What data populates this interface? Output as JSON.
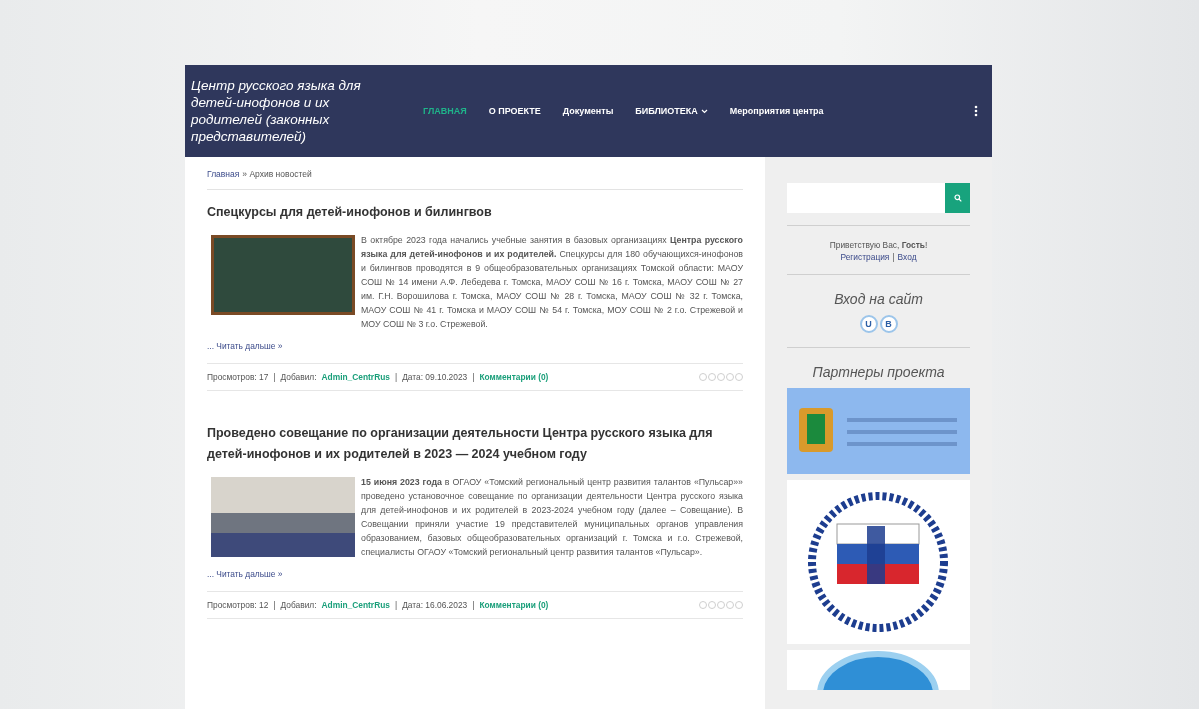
{
  "header": {
    "site_title": "Центр русского языка для детей-инофонов и их родителей (законных представителей)",
    "nav": [
      {
        "label": "ГЛАВНАЯ",
        "selected": true,
        "dropdown": false
      },
      {
        "label": "О ПРОЕКТЕ",
        "selected": false,
        "dropdown": false
      },
      {
        "label": "Документы",
        "selected": false,
        "dropdown": false
      },
      {
        "label": "БИБЛИОТЕКА",
        "selected": false,
        "dropdown": true
      },
      {
        "label": "Мероприятия центра",
        "selected": false,
        "dropdown": false
      }
    ]
  },
  "breadcrumb": [
    {
      "text": "Главная",
      "kind": "link"
    },
    {
      "text": "» Архив новостей",
      "kind": "text"
    }
  ],
  "articles": [
    {
      "title": "Спецкурсы для детей-инофонов и билингвов",
      "kind": "chalkboard",
      "body": "В октябре 2023 года начались учебные занятия в базовых организациях **Центра русского языка для детей-инофонов и их родителей.** Спецкурсы для 180 обучающихся-инофонов и билингвов проводятся в 9 общеобразовательных организациях Томской области: МАОУ СОШ № 14 имени А.Ф. Лебедева г. Томска, МАОУ СОШ № 16 г. Томска, МАОУ СОШ № 27 им. Г.Н. Ворошилова г. Томска, МАОУ СОШ № 28 г. Томска, МАОУ СОШ № 32 г. Томска, МАОУ СОШ № 41 г. Томска и МАОУ СОШ № 54 г. Томска, МОУ СОШ № 2 г.о. Стрежевой и МОУ СОШ № 3 г.о. Стрежевой.",
      "read_more": "... Читать дальше »",
      "stars": 0,
      "meta": [
        {
          "text": "Просмотров: 17",
          "kind": "text"
        },
        {
          "text": "|",
          "kind": "sep"
        },
        {
          "text": "Добавил:",
          "kind": "text"
        },
        {
          "text": "Admin_CentrRus",
          "kind": "link"
        },
        {
          "text": "|",
          "kind": "sep"
        },
        {
          "text": "Дата: 09.10.2023",
          "kind": "text"
        },
        {
          "text": "|",
          "kind": "sep"
        },
        {
          "text": "Комментарии (0)",
          "kind": "link"
        }
      ]
    },
    {
      "title": "Проведено совещание по организации деятельности Центра русского языка для детей-инофонов и их родителей в 2023 — 2024 учебном году",
      "kind": "photo",
      "body": "**15 июня 2023 года** в ОГАОУ «Томский региональный центр развития талантов «Пульсар»» проведено установочное совещание по организации деятельности Центра русского языка для детей-инофонов и их родителей в 2023-2024 учебном году (далее – Совещание). В Совещании приняли участие 19 представителей муниципальных органов управления образованием, базовых общеобразовательных организаций г. Томска и г.о. Стрежевой, специалисты ОГАОУ «Томский региональный центр развития талантов «Пульсар».",
      "read_more": "... Читать дальше »",
      "stars": 0,
      "meta": [
        {
          "text": "Просмотров: 12",
          "kind": "text"
        },
        {
          "text": "|",
          "kind": "sep"
        },
        {
          "text": "Добавил:",
          "kind": "text"
        },
        {
          "text": "Admin_CentrRus",
          "kind": "link"
        },
        {
          "text": "|",
          "kind": "sep"
        },
        {
          "text": "Дата: 16.06.2023",
          "kind": "text"
        },
        {
          "text": "|",
          "kind": "sep"
        },
        {
          "text": "Комментарии (0)",
          "kind": "link"
        }
      ]
    }
  ],
  "sidebar": {
    "greeting": "Приветствую Вас, **Гость**!",
    "auth_links": [
      {
        "text": "Регистрация",
        "kind": "link"
      },
      {
        "text": "|",
        "kind": "sep"
      },
      {
        "text": "Вход",
        "kind": "link"
      }
    ],
    "login_title": "Вход на сайт",
    "login_buttons": [
      "U",
      "B"
    ],
    "partners_title": "Партнеры проекта",
    "partners": [
      {
        "kind": "banner"
      },
      {
        "kind": "emblem"
      },
      {
        "kind": "round-emblem"
      }
    ]
  }
}
